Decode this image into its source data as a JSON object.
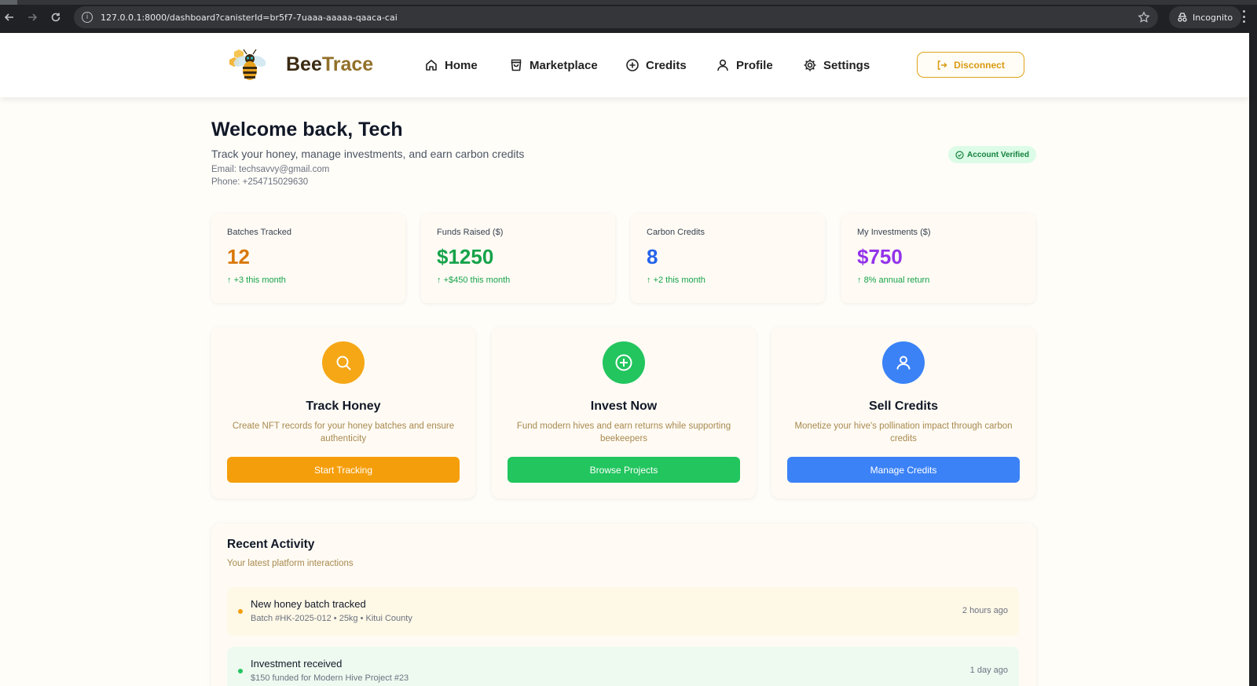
{
  "browser": {
    "url": "127.0.0.1:8000/dashboard?canisterId=br5f7-7uaaa-aaaaa-qaaca-cai",
    "profile_label": "Incognito"
  },
  "header": {
    "brand_part1": "Bee",
    "brand_part2": "Trace",
    "nav": [
      {
        "label": "Home",
        "icon": "home-icon"
      },
      {
        "label": "Marketplace",
        "icon": "shopping-bag-icon"
      },
      {
        "label": "Credits",
        "icon": "plus-circle-icon"
      },
      {
        "label": "Profile",
        "icon": "user-icon"
      },
      {
        "label": "Settings",
        "icon": "gear-icon"
      }
    ],
    "disconnect_label": "Disconnect"
  },
  "welcome": {
    "title": "Welcome back, Tech",
    "subtitle": "Track your honey, manage investments, and earn carbon credits",
    "email": "Email: techsavvy@gmail.com",
    "phone": "Phone: +254715029630",
    "badge": "Account Verified"
  },
  "stats": [
    {
      "label": "Batches Tracked",
      "value": "12",
      "delta": "+3 this month",
      "color": "#d97706"
    },
    {
      "label": "Funds Raised ($)",
      "value": "$1250",
      "delta": "+$450 this month",
      "color": "#16a34a"
    },
    {
      "label": "Carbon Credits",
      "value": "8",
      "delta": "+2 this month",
      "color": "#2563eb"
    },
    {
      "label": "My Investments ($)",
      "value": "$750",
      "delta": "8% annual return",
      "color": "#9333ea"
    }
  ],
  "actions": [
    {
      "title": "Track Honey",
      "description": "Create NFT records for your honey batches and ensure authenticity",
      "button": "Start Tracking",
      "color": "#f59e0b",
      "icon": "search-icon"
    },
    {
      "title": "Invest Now",
      "description": "Fund modern hives and earn returns while supporting beekeepers",
      "button": "Browse Projects",
      "color": "#22c55e",
      "icon": "plus-circle-icon"
    },
    {
      "title": "Sell Credits",
      "description": "Monetize your hive's pollination impact through carbon credits",
      "button": "Manage Credits",
      "color": "#3b82f6",
      "icon": "user-icon"
    }
  ],
  "activity": {
    "title": "Recent Activity",
    "subtitle": "Your latest platform interactions",
    "items": [
      {
        "title": "New honey batch tracked",
        "detail": "Batch #HK-2025-012 • 25kg • Kitui County",
        "time": "2 hours ago",
        "dot_color": "#f59e0b",
        "bg": "#fef8e6"
      },
      {
        "title": "Investment received",
        "detail": "$150 funded for Modern Hive Project #23",
        "time": "1 day ago",
        "dot_color": "#22c55e",
        "bg": "#eefaf0"
      }
    ]
  }
}
